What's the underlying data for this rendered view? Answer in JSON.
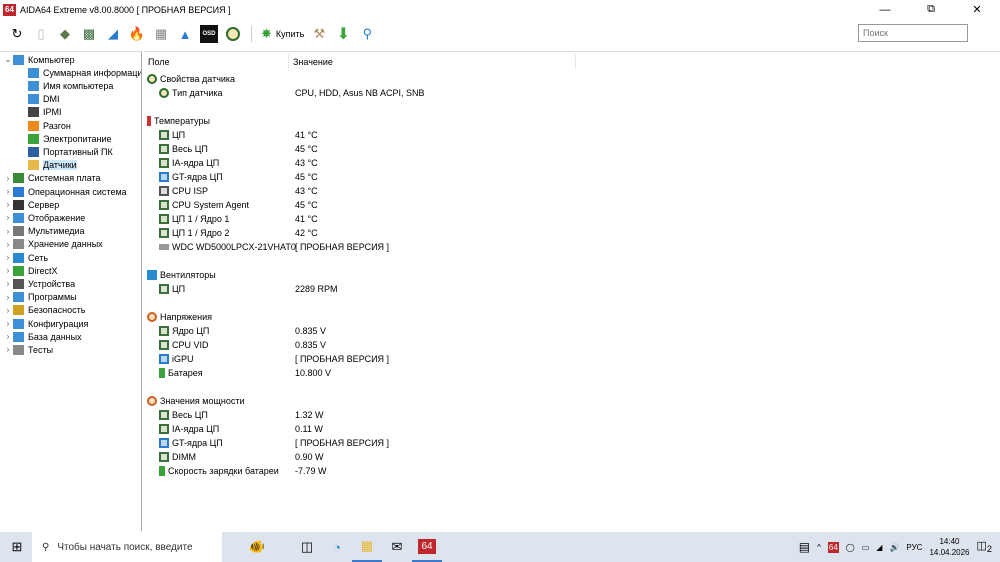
{
  "window": {
    "title": "AIDA64 Extreme v8.00.8000  [ ПРОБНАЯ ВЕРСИЯ ]",
    "app_icon": "64"
  },
  "toolbar": {
    "buy_label": "Купить",
    "search_placeholder": "Поиск",
    "osd_label": "OSD"
  },
  "tree": [
    {
      "label": "Компьютер",
      "level": 0,
      "expanded": true,
      "color": "#3d8fd6"
    },
    {
      "label": "Суммарная информация",
      "level": 1,
      "color": "#3d8fd6"
    },
    {
      "label": "Имя компьютера",
      "level": 1,
      "color": "#3d8fd6"
    },
    {
      "label": "DMI",
      "level": 1,
      "color": "#3d8fd6"
    },
    {
      "label": "IPMI",
      "level": 1,
      "color": "#444"
    },
    {
      "label": "Разгон",
      "level": 1,
      "color": "#f08a1c"
    },
    {
      "label": "Электропитание",
      "level": 1,
      "color": "#3aa23a"
    },
    {
      "label": "Портативный ПК",
      "level": 1,
      "color": "#2d5fa0"
    },
    {
      "label": "Датчики",
      "level": 1,
      "color": "#e8b84a",
      "selected": true
    },
    {
      "label": "Системная плата",
      "level": 0,
      "color": "#3a8a3a"
    },
    {
      "label": "Операционная система",
      "level": 0,
      "color": "#2a7bd0"
    },
    {
      "label": "Сервер",
      "level": 0,
      "color": "#333"
    },
    {
      "label": "Отображение",
      "level": 0,
      "color": "#3d8fd6"
    },
    {
      "label": "Мультимедиа",
      "level": 0,
      "color": "#777"
    },
    {
      "label": "Хранение данных",
      "level": 0,
      "color": "#888"
    },
    {
      "label": "Сеть",
      "level": 0,
      "color": "#2a8ad0"
    },
    {
      "label": "DirectX",
      "level": 0,
      "color": "#3aa23a"
    },
    {
      "label": "Устройства",
      "level": 0,
      "color": "#555"
    },
    {
      "label": "Программы",
      "level": 0,
      "color": "#3d8fd6"
    },
    {
      "label": "Безопасность",
      "level": 0,
      "color": "#d0a020"
    },
    {
      "label": "Конфигурация",
      "level": 0,
      "color": "#3d8fd6"
    },
    {
      "label": "База данных",
      "level": 0,
      "color": "#3d8fd6"
    },
    {
      "label": "Тесты",
      "level": 0,
      "color": "#888"
    }
  ],
  "columns": {
    "field": "Поле",
    "value": "Значение"
  },
  "sections": [
    {
      "title": "Свойства датчика",
      "icon": "gauge",
      "items": [
        {
          "field": "Тип датчика",
          "value": "CPU, HDD, Asus NB ACPI, SNB",
          "icon": "gauge"
        }
      ]
    },
    {
      "title": "Температуры",
      "icon": "thermometer",
      "items": [
        {
          "field": "ЦП",
          "value": "41 °C",
          "icon": "chip"
        },
        {
          "field": "Весь ЦП",
          "value": "45 °C",
          "icon": "chip"
        },
        {
          "field": "IA-ядра ЦП",
          "value": "43 °C",
          "icon": "chip"
        },
        {
          "field": "GT-ядра ЦП",
          "value": "45 °C",
          "icon": "gpu"
        },
        {
          "field": "CPU ISP",
          "value": "43 °C",
          "icon": "camera"
        },
        {
          "field": "CPU System Agent",
          "value": "45 °C",
          "icon": "chip"
        },
        {
          "field": "ЦП 1 / Ядро 1",
          "value": "41 °C",
          "icon": "chip"
        },
        {
          "field": "ЦП 1 / Ядро 2",
          "value": "42 °C",
          "icon": "chip"
        },
        {
          "field": "WDC WD5000LPCX-21VHAT0",
          "value": "[ ПРОБНАЯ ВЕРСИЯ ]",
          "icon": "disk"
        }
      ]
    },
    {
      "title": "Вентиляторы",
      "icon": "fan",
      "items": [
        {
          "field": "ЦП",
          "value": "2289 RPM",
          "icon": "chip"
        }
      ]
    },
    {
      "title": "Напряжения",
      "icon": "voltage",
      "items": [
        {
          "field": "Ядро ЦП",
          "value": "0.835 V",
          "icon": "chip"
        },
        {
          "field": "CPU VID",
          "value": "0.835 V",
          "icon": "chip"
        },
        {
          "field": "iGPU",
          "value": "[ ПРОБНАЯ ВЕРСИЯ ]",
          "icon": "gpu"
        },
        {
          "field": "Батарея",
          "value": "10.800 V",
          "icon": "battery"
        }
      ]
    },
    {
      "title": "Значения мощности",
      "icon": "voltage",
      "items": [
        {
          "field": "Весь ЦП",
          "value": "1.32 W",
          "icon": "chip"
        },
        {
          "field": "IA-ядра ЦП",
          "value": "0.11 W",
          "icon": "chip"
        },
        {
          "field": "GT-ядра ЦП",
          "value": "[ ПРОБНАЯ ВЕРСИЯ ]",
          "icon": "gpu"
        },
        {
          "field": "DIMM",
          "value": "0.90 W",
          "icon": "chip"
        },
        {
          "field": "Скорость зарядки батареи",
          "value": "-7.79 W",
          "icon": "battery"
        }
      ]
    }
  ],
  "taskbar": {
    "search_placeholder": "Чтобы начать поиск, введите",
    "aida_label": "64",
    "lang": "РУС",
    "time": "14:40",
    "date": "14.04.2026",
    "notifications": "2"
  }
}
